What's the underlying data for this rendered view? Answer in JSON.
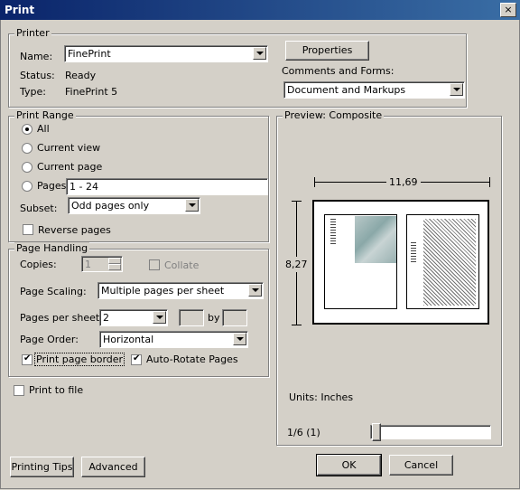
{
  "window": {
    "title": "Print",
    "close": "×"
  },
  "printer": {
    "group_label": "Printer",
    "name_label": "Name:",
    "name_value": "FinePrint",
    "status_label": "Status:",
    "status_value": "Ready",
    "type_label": "Type:",
    "type_value": "FinePrint 5",
    "properties_button": "Properties",
    "comments_label": "Comments and Forms:",
    "comments_value": "Document and Markups"
  },
  "print_range": {
    "group_label": "Print Range",
    "options": [
      "All",
      "Current view",
      "Current page",
      "Pages"
    ],
    "selected": "All",
    "pages_value": "1 - 24",
    "subset_label": "Subset:",
    "subset_value": "Odd pages only",
    "reverse_label": "Reverse pages",
    "reverse_checked": false
  },
  "page_handling": {
    "group_label": "Page Handling",
    "copies_label": "Copies:",
    "copies_value": "1",
    "collate_label": "Collate",
    "scaling_label": "Page Scaling:",
    "scaling_value": "Multiple pages per sheet",
    "pps_label": "Pages per sheet:",
    "pps_value": "2",
    "by_label": "by",
    "order_label": "Page Order:",
    "order_value": "Horizontal",
    "border_label": "Print page border",
    "border_checked": true,
    "autorotate_label": "Auto-Rotate Pages",
    "autorotate_checked": true
  },
  "print_to_file": {
    "label": "Print to file",
    "checked": false
  },
  "preview": {
    "group_label": "Preview: Composite",
    "width_value": "11,69",
    "height_value": "8,27",
    "units": "Units: Inches",
    "page_indicator": "1/6 (1)",
    "slider_position": 0
  },
  "footer": {
    "tips_button": "Printing Tips",
    "advanced_button": "Advanced",
    "ok_button": "OK",
    "cancel_button": "Cancel"
  }
}
